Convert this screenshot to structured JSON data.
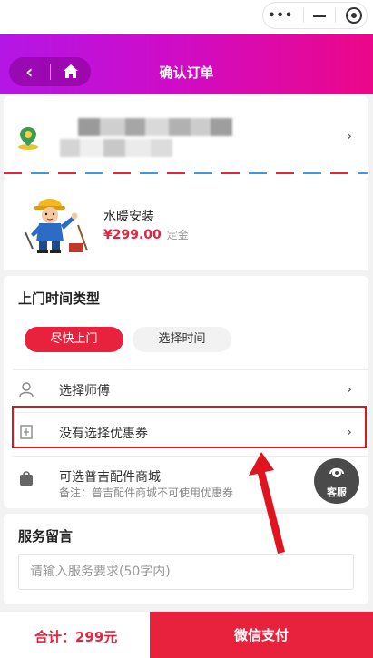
{
  "header": {
    "title": "确认订单"
  },
  "goods": {
    "name": "水暖安装",
    "price": "¥299.00",
    "unit": "定金"
  },
  "visit_type": {
    "title": "上门时间类型",
    "asap_label": "尽快上门",
    "schedule_label": "选择时间"
  },
  "rows": {
    "technician": "选择师傅",
    "coupon": "没有选择优惠券",
    "mall": "可选普吉配件商城",
    "mall_note": "备注：普吉配件商城不可使用优惠券"
  },
  "support": {
    "label": "客服"
  },
  "message": {
    "title": "服务留言",
    "placeholder": "请输入服务要求(50字内)"
  },
  "footer": {
    "total": "合计：299元",
    "pay_label": "微信支付"
  },
  "colors": {
    "accent": "#e8223c",
    "nav_gradient_start": "#b416e6",
    "nav_gradient_end": "#ec0788",
    "annotation": "#e0141e"
  }
}
